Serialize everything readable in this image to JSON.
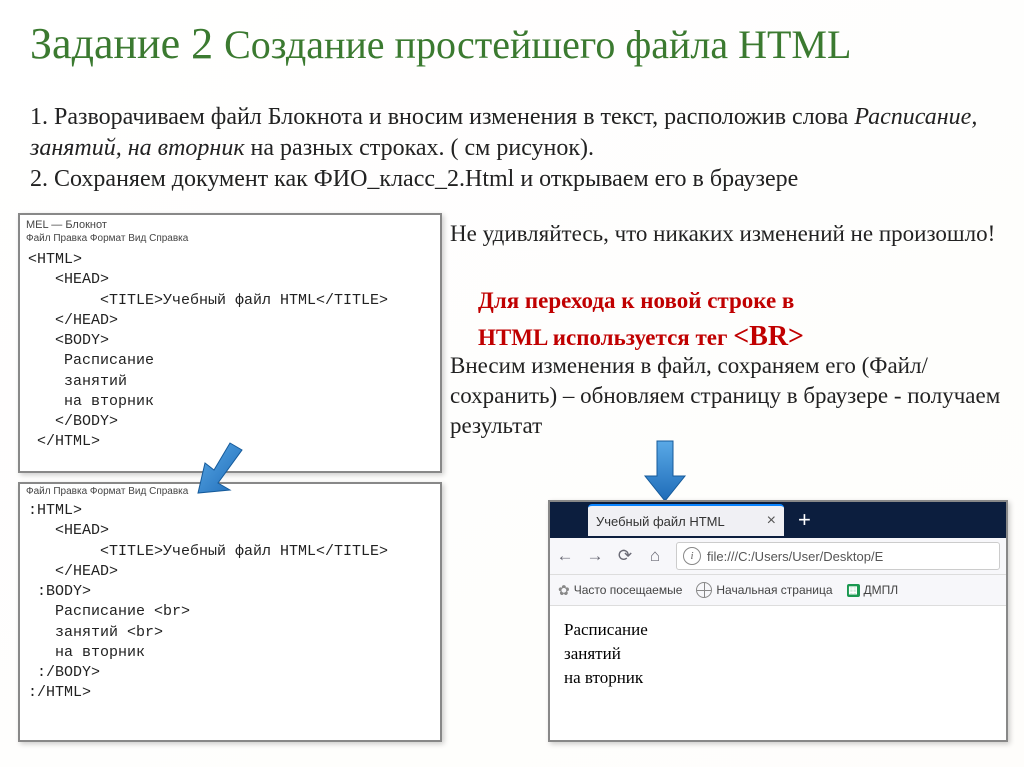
{
  "title_prefix": "Задание 2 ",
  "title_main": "Создание простейшего файла HTML",
  "instructions_html": "1. Разворачиваем файл Блокнота и вносим изменения в текст, расположив слова <i>Расписание, занятий, на вторник</i> на разных строках. ( см рисунок).<br>2. Сохраняем документ как ФИО_класс_2.Html и открываем его в браузере",
  "notepad1": {
    "window_title": "MEL — Блокнот",
    "menu": "Файл  Правка  Формат  Вид  Справка",
    "body": "<HTML>\n   <HEAD>\n        <TITLE>Учебный файл HTML</TITLE>\n   </HEAD>\n   <BODY>\n    Расписание\n    занятий\n    на вторник\n   </BODY>\n </HTML>"
  },
  "notepad2": {
    "menu": "Файл  Правка  Формат  Вид  Справка",
    "body": ":HTML>\n   <HEAD>\n        <TITLE>Учебный файл HTML</TITLE>\n   </HEAD>\n :BODY>\n   Расписание <br>\n   занятий <br>\n   на вторник\n :/BODY>\n:/HTML>"
  },
  "side1": "Не удивляйтесь, что никаких изменений не произошло!",
  "side2_line1": "Для перехода к новой строке в",
  "side2_line2": "HTML используется тег ",
  "side2_tag": "<BR>",
  "side3": "Внесим изменения в файл, сохраняем его (Файл/сохранить) – обновляем страницу в браузере - получаем результат",
  "browser": {
    "tab_title": "Учебный файл HTML",
    "url": "file:///C:/Users/User/Desktop/E",
    "bookmark1": "Часто посещаемые",
    "bookmark2": "Начальная страница",
    "bookmark3": "ДМПЛ",
    "content_line1": "Расписание",
    "content_line2": "занятий",
    "content_line3": "на вторник"
  }
}
